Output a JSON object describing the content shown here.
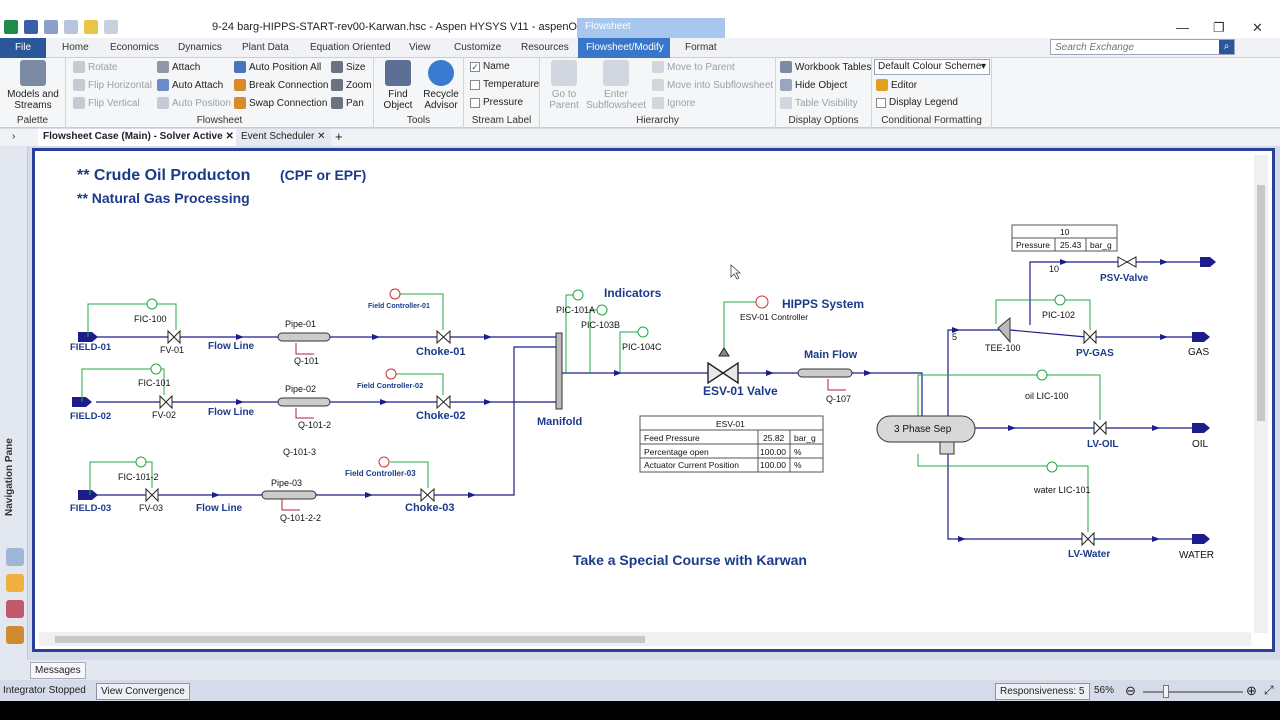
{
  "window": {
    "title": "9-24 barg-HIPPS-START-rev00-Karwan.hsc - Aspen HYSYS V11 - aspenONE",
    "context_group": "Flowsheet",
    "controls": {
      "minimize": "—",
      "maximize": "❐",
      "close": "✕"
    }
  },
  "ribbon_tabs": [
    "File",
    "Home",
    "Economics",
    "Dynamics",
    "Plant Data",
    "Equation Oriented",
    "View",
    "Customize",
    "Resources",
    "Flowsheet/Modify",
    "Format"
  ],
  "search": {
    "placeholder": "Search Exchange"
  },
  "ribbon": {
    "palette": {
      "label": "Palette",
      "models_streams": "Models and Streams"
    },
    "flowsheet": {
      "label": "Flowsheet",
      "rotate": "Rotate",
      "flip_h": "Flip Horizontal",
      "flip_v": "Flip Vertical",
      "attach": "Attach",
      "auto_attach": "Auto Attach",
      "auto_position": "Auto Position",
      "auto_position_all": "Auto Position All",
      "break_connection": "Break Connection",
      "swap_connection": "Swap Connection",
      "size": "Size",
      "zoom": "Zoom",
      "pan": "Pan"
    },
    "tools": {
      "label": "Tools",
      "find_object": "Find Object",
      "recycle_advisor": "Recycle Advisor"
    },
    "stream_label": {
      "label": "Stream Label",
      "name": "Name",
      "temperature": "Temperature",
      "pressure": "Pressure"
    },
    "hierarchy": {
      "label": "Hierarchy",
      "go_to_parent": "Go to Parent",
      "enter_subflowsheet": "Enter Subflowsheet",
      "move_to_parent": "Move to Parent",
      "move_into_subflowsheet": "Move into Subflowsheet",
      "ignore": "Ignore"
    },
    "display_options": {
      "label": "Display Options",
      "workbook_tables": "Workbook Tables",
      "hide_object": "Hide Object",
      "table_visibility": "Table Visibility"
    },
    "conditional_formatting": {
      "label": "Conditional Formatting",
      "color_scheme": "Default Colour Scheme",
      "editor": "Editor",
      "display_legend": "Display Legend"
    }
  },
  "doc_tabs": [
    {
      "label": "Flowsheet Case (Main) - Solver Active"
    },
    {
      "label": "Event Scheduler"
    }
  ],
  "nav_pane": {
    "label": "Navigation Pane"
  },
  "flowsheet": {
    "heading1": "** Crude Oil Producton",
    "heading1b": "(CPF or EPF)",
    "heading2": "** Natural Gas Processing",
    "indicators": "Indicators",
    "hipps_system": "HIPPS System",
    "main_flow": "Main Flow",
    "manifold": "Manifold",
    "promo": "Take a Special Course with Karwan",
    "fields": [
      "FIELD-01",
      "FIELD-02",
      "FIELD-03"
    ],
    "fics": [
      "FIC-100",
      "FIC-101",
      "FIC-101-2"
    ],
    "fvs": [
      "FV-01",
      "FV-02",
      "FV-03"
    ],
    "flowlines": [
      "Flow Line",
      "Flow Line",
      "Flow Line"
    ],
    "pipes": [
      "Pipe-01",
      "Pipe-02",
      "Pipe-03"
    ],
    "qs": [
      "Q-101",
      "Q-101-2",
      "Q-101-2-2"
    ],
    "q_extra": "Q-101-3",
    "field_controllers": [
      "Field Controller-01",
      "Field Controller-02",
      "Field Controller-03"
    ],
    "chokes": [
      "Choke-01",
      "Choke-02",
      "Choke-03"
    ],
    "pic_101a": "PIC-101A",
    "pic_103b": "PIC-103B",
    "pic_104c": "PIC-104C",
    "esv_controller": "ESV-01 Controller",
    "esv_valve": "ESV-01 Valve",
    "q_107": "Q-107",
    "esv_table": {
      "title": "ESV-01",
      "rows": [
        {
          "k": "Feed Pressure",
          "v": "25.82",
          "u": "bar_g"
        },
        {
          "k": "Percentage open",
          "v": "100.00",
          "u": "%"
        },
        {
          "k": "Actuator Current Position",
          "v": "100.00",
          "u": "%"
        }
      ]
    },
    "psv_table": {
      "title": "10",
      "k": "Pressure",
      "v": "25.43",
      "u": "bar_g"
    },
    "stream_10": "10",
    "stream_5": "5",
    "psv_valve": "PSV-Valve",
    "pic_102": "PIC-102",
    "tee": "TEE-100",
    "pv_gas": "PV-GAS",
    "gas": "GAS",
    "separator": "3 Phase Sep",
    "lic_100": "oil LIC-100",
    "lv_oil": "LV-OIL",
    "oil": "OIL",
    "lic_101": "water LIC-101",
    "lv_water": "LV-Water",
    "water": "WATER"
  },
  "messages_tab": "Messages",
  "status": {
    "integrator": "Integrator Stopped",
    "view_convergence": "View Convergence",
    "responsiveness": "Responsiveness: 5",
    "zoom": "56%"
  },
  "colors": {
    "stream": "#1c1c8c",
    "label": "#1c3a8a",
    "controller": "#22a845",
    "frame": "#2a3f9a",
    "ribbon_accent": "#2b579a"
  }
}
